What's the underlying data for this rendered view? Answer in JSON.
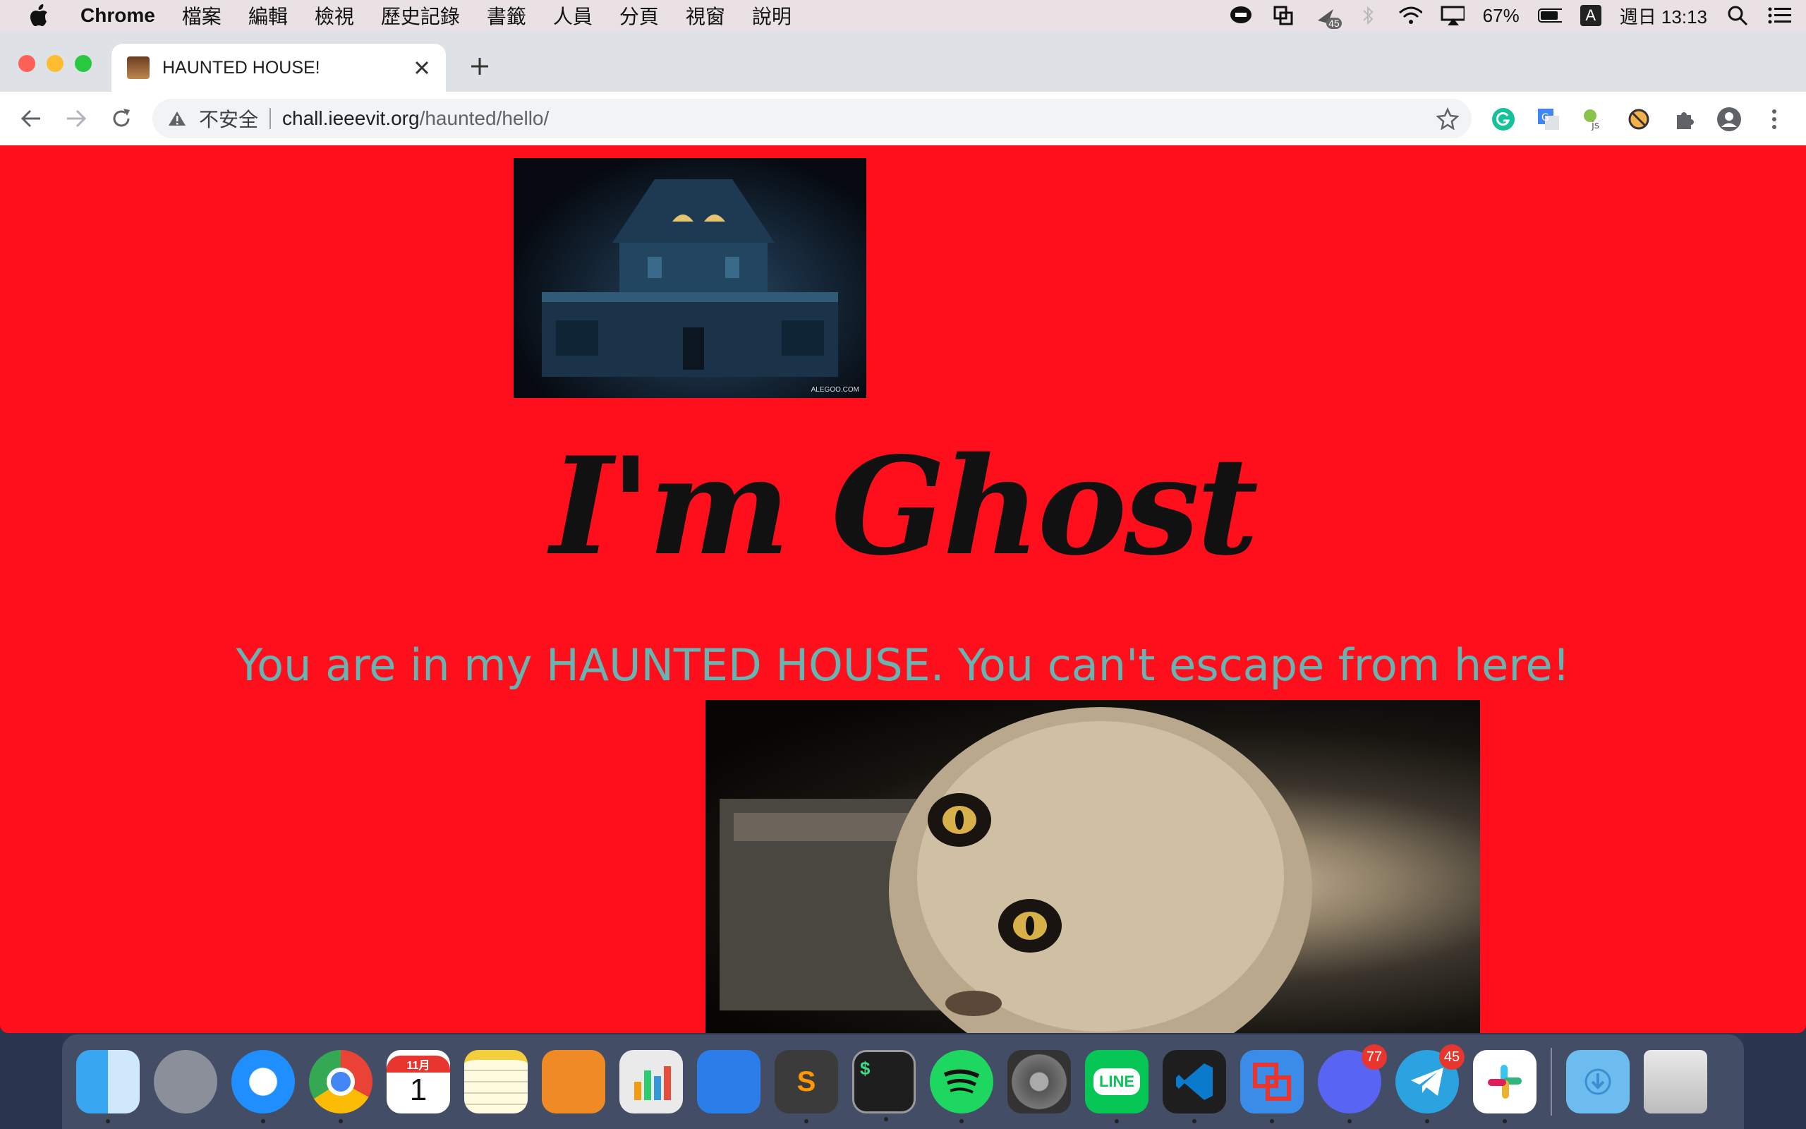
{
  "menubar": {
    "app_name": "Chrome",
    "items": [
      "檔案",
      "編輯",
      "檢視",
      "歷史記錄",
      "書籤",
      "人員",
      "分頁",
      "視窗",
      "說明"
    ],
    "status": {
      "airdrop_badge": "45",
      "battery": "67%",
      "input_source": "A",
      "clock": "週日 13:13"
    }
  },
  "browser": {
    "tab_title": "HAUNTED HOUSE!",
    "security_label": "不安全",
    "url_host": "chall.ieeevit.org",
    "url_path": "/haunted/hello/"
  },
  "page": {
    "house_watermark": "ALEGOO.COM",
    "title": "I'm Ghost",
    "subtitle": "You are in my HAUNTED HOUSE. You can't escape from here!",
    "background_color": "#ff0f1c",
    "subtitle_color": "#66b5b3"
  },
  "dock": {
    "calendar_month": "11月",
    "calendar_day": "1",
    "line_label": "LINE",
    "terminal_label": "$",
    "discord_badge": "77",
    "telegram_badge": "45"
  }
}
